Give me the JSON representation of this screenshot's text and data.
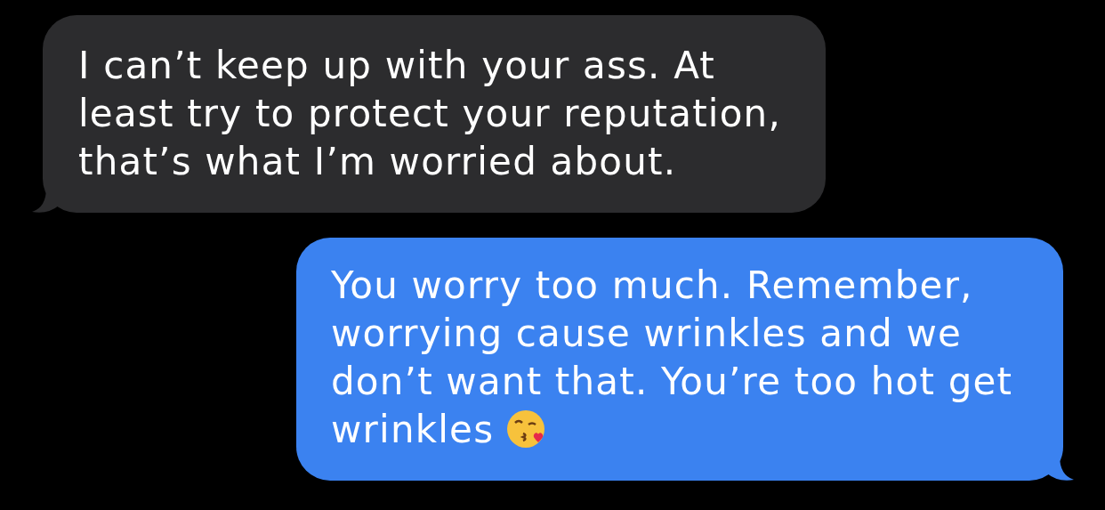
{
  "messages": [
    {
      "kind": "incoming",
      "text": "I can’t keep up with your ass. At least try to protect your reputation, that’s what I’m worried about."
    },
    {
      "kind": "outgoing",
      "text": "You worry too much. Remember, worrying cause wrinkles and we don’t want that. You’re too hot get wrinkles",
      "emoji": true
    }
  ]
}
